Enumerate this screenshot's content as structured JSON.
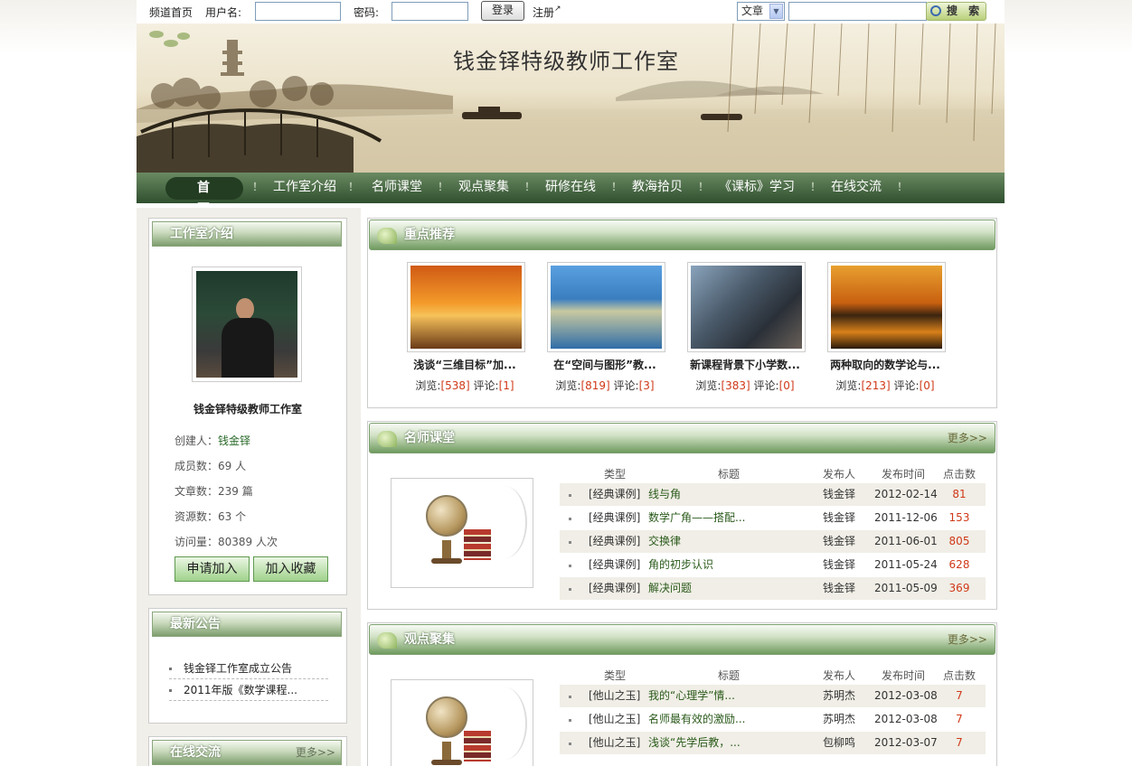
{
  "topbar": {
    "home_link": "频道首页",
    "username_label": "用户名:",
    "password_label": "密码:",
    "login_button": "登录",
    "register_link": "注册",
    "search_type": "文章",
    "search_button": "搜 索"
  },
  "banner": {
    "title": "钱金铎特级教师工作室"
  },
  "nav": {
    "items": [
      "首 页",
      "工作室介绍",
      "名师课堂",
      "观点聚集",
      "研修在线",
      "教海拾贝",
      "《课标》学习",
      "在线交流"
    ],
    "separator": "！"
  },
  "sidebar": {
    "intro_title": "工作室介绍",
    "studio_name": "钱金铎特级教师工作室",
    "creator_label": "创建人：",
    "creator": "钱金铎",
    "members": "成员数：69 人",
    "articles": "文章数：239 篇",
    "resources": "资源数：63 个",
    "visits": "访问量：80389 人次",
    "join_button": "申请加入",
    "favorite_button": "加入收藏",
    "notice_title": "最新公告",
    "notices": [
      "钱金铎工作室成立公告",
      "2011年版《数学课程..."
    ],
    "online_title": "在线交流",
    "online_more": "更多>>"
  },
  "featured": {
    "title": "重点推荐",
    "items": [
      {
        "caption": "浅谈“三维目标”加...",
        "views_label": "浏览:",
        "views": "[538]",
        "comments_label": " 评论:",
        "comments": "[1]"
      },
      {
        "caption": "在“空间与图形”教...",
        "views_label": "浏览:",
        "views": "[819]",
        "comments_label": " 评论:",
        "comments": "[3]"
      },
      {
        "caption": "新课程背景下小学数...",
        "views_label": "浏览:",
        "views": "[383]",
        "comments_label": " 评论:",
        "comments": "[0]"
      },
      {
        "caption": "两种取向的数学论与...",
        "views_label": "浏览:",
        "views": "[213]",
        "comments_label": " 评论:",
        "comments": "[0]"
      }
    ]
  },
  "classroom": {
    "title": "名师课堂",
    "more": "更多>>",
    "headers": [
      "类型",
      "标题",
      "发布人",
      "发布时间",
      "点击数"
    ],
    "rows": [
      {
        "type": "[经典课例]",
        "title": "线与角",
        "author": "钱金铎",
        "date": "2012-02-14",
        "hits": "81"
      },
      {
        "type": "[经典课例]",
        "title": "数学广角——搭配...",
        "author": "钱金铎",
        "date": "2011-12-06",
        "hits": "153"
      },
      {
        "type": "[经典课例]",
        "title": "交换律",
        "author": "钱金铎",
        "date": "2011-06-01",
        "hits": "805"
      },
      {
        "type": "[经典课例]",
        "title": "角的初步认识",
        "author": "钱金铎",
        "date": "2011-05-24",
        "hits": "628"
      },
      {
        "type": "[经典课例]",
        "title": "解决问题",
        "author": "钱金铎",
        "date": "2011-05-09",
        "hits": "369"
      }
    ]
  },
  "viewpoints": {
    "title": "观点聚集",
    "more": "更多>>",
    "headers": [
      "类型",
      "标题",
      "发布人",
      "发布时间",
      "点击数"
    ],
    "rows": [
      {
        "type": "[他山之玉]",
        "title": "我的“心理学”情...",
        "author": "苏明杰",
        "date": "2012-03-08",
        "hits": "7"
      },
      {
        "type": "[他山之玉]",
        "title": "名师最有效的激励...",
        "author": "苏明杰",
        "date": "2012-03-08",
        "hits": "7"
      },
      {
        "type": "[他山之玉]",
        "title": "浅谈“先学后教，...",
        "author": "包柳鸣",
        "date": "2012-03-07",
        "hits": "7"
      }
    ]
  },
  "colors": {
    "nav_green": "#2f4f2e",
    "accent_red": "#d03818",
    "link_green": "#2a5a1a"
  }
}
